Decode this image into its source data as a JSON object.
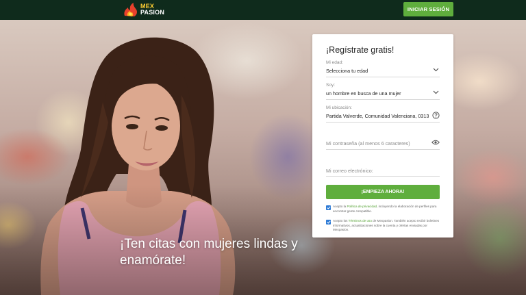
{
  "header": {
    "logo_line1": "MEX",
    "logo_line2": "PASION",
    "login_label": "INICIAR SESIÓN"
  },
  "hero": {
    "tagline_line1": "¡Ten citas con mujeres lindas y",
    "tagline_line2": "enamórate!"
  },
  "form": {
    "title": "¡Regístrate gratis!",
    "age": {
      "label": "Mi edad:",
      "value": "Selecciona tu edad"
    },
    "gender": {
      "label": "Soy:",
      "value": "un hombre en busca de una mujer"
    },
    "location": {
      "label": "Mi ubicación:",
      "value": "Partida Valverde, Comunidad Valenciana, 0313"
    },
    "password": {
      "placeholder": "Mi contraseña (al menos 6 caracteres)"
    },
    "email": {
      "placeholder": "Mi correo electrónico:"
    },
    "submit_label": "¡EMPIEZA AHORA!",
    "consent_privacy": {
      "prefix": "Acepto la ",
      "link": "Política de privacidad",
      "suffix": ", incluyendo la elaboración de perfiles para encontrar gente compatible."
    },
    "consent_terms": {
      "prefix": "Acepto los ",
      "link": "Términos de uso",
      "suffix": " de Mexpasion. También acepto recibir boletines informativos, actualizaciones sobre la cuenta y ofertas enviadas por Mexpasion."
    }
  },
  "colors": {
    "header_bg": "#0f2b1c",
    "accent_green": "#5fae3d",
    "checkbox_blue": "#2e7bd6",
    "link_green": "#4c9d2a"
  },
  "icons": {
    "logo": "flame-logo-icon",
    "age_dropdown": "chevron-down-icon",
    "gender_dropdown": "chevron-down-icon",
    "location_help": "question-circle-icon",
    "password_toggle": "eye-icon",
    "checkbox": "checkmark-icon"
  }
}
